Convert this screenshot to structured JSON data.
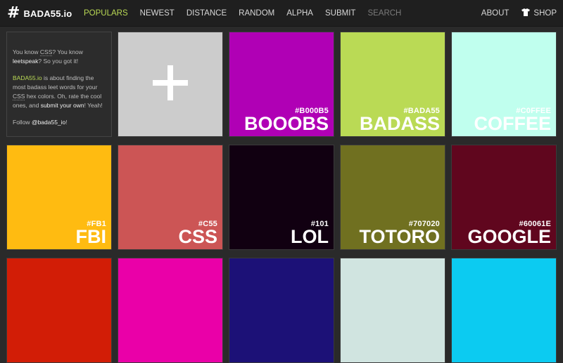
{
  "brand": {
    "hash": "#",
    "name": "BADA55.io"
  },
  "nav": {
    "items": [
      {
        "label": "POPULARS",
        "active": true
      },
      {
        "label": "NEWEST"
      },
      {
        "label": "DISTANCE"
      },
      {
        "label": "RANDOM"
      },
      {
        "label": "ALPHA"
      },
      {
        "label": "SUBMIT"
      }
    ],
    "search_placeholder": "SEARCH",
    "about": "ABOUT",
    "shop": "SHOP"
  },
  "info": {
    "p1_a": "You know ",
    "p1_css": "CSS",
    "p1_b": "? You know ",
    "p1_leet": "leetspeak",
    "p1_c": "? So you got it!",
    "p2_brand": "BADA55.io",
    "p2_a": " is about finding the most badass leet words for your ",
    "p2_css": "CSS",
    "p2_b": " hex colors. Oh, rate the cool ones, and ",
    "p2_submit": "submit your own",
    "p2_c": "! Yeah!",
    "p3_a": "Follow ",
    "p3_handle": "@bada55_io",
    "p3_b": "!"
  },
  "tiles": [
    {
      "hex": "#B000B5",
      "word": "BOOOBS",
      "color": "#b000b5"
    },
    {
      "hex": "#BADA55",
      "word": "BADASS",
      "color": "#bada55"
    },
    {
      "hex": "#C0FFEE",
      "word": "COFFEE",
      "color": "#c0ffee"
    },
    {
      "hex": "#FB1",
      "word": "FBI",
      "color": "#ffbb11"
    },
    {
      "hex": "#C55",
      "word": "CSS",
      "color": "#cc5555"
    },
    {
      "hex": "#101",
      "word": "LOL",
      "color": "#110011"
    },
    {
      "hex": "#707020",
      "word": "TOTORO",
      "color": "#707020"
    },
    {
      "hex": "#60061E",
      "word": "GOOGLE",
      "color": "#60061e"
    },
    {
      "hex": "",
      "word": "",
      "color": "#d21d06"
    },
    {
      "hex": "",
      "word": "",
      "color": "#ea00a8"
    },
    {
      "hex": "",
      "word": "",
      "color": "#1c1177"
    },
    {
      "hex": "",
      "word": "",
      "color": "#d0e4e0"
    },
    {
      "hex": "",
      "word": "",
      "color": "#0ccbf1"
    }
  ]
}
